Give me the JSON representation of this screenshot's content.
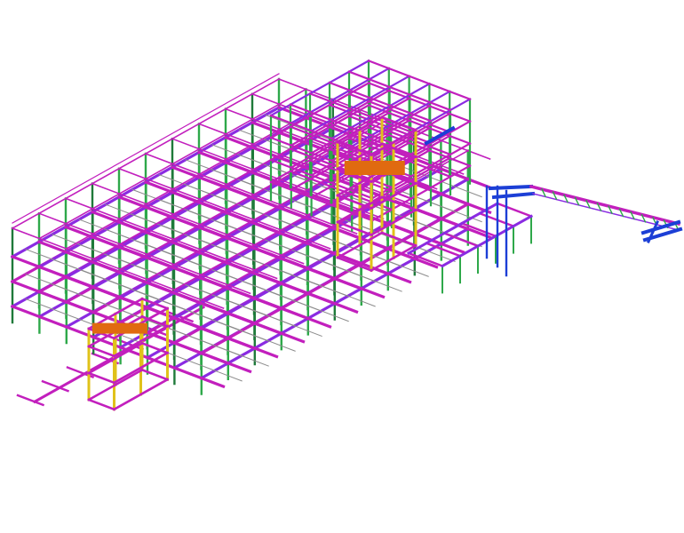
{
  "viewport": {
    "background": "#ffffff"
  },
  "model": {
    "view": "isometric-3d",
    "description_type": "structural-steel-frame",
    "colors": {
      "beam_primary": "#c21fbd",
      "beam_secondary": "#8a2be2",
      "column": "#2ea84a",
      "column_alt": "#1f7a3a",
      "brace": "#e0c21a",
      "stair_bracing": "#f0d000",
      "platform_orange": "#e06a10",
      "conveyor_blue": "#1c3fd6",
      "grey_member": "#8c8c8c",
      "pipe_cyan": "#1aa7c9"
    },
    "icons": {
      "main_frame": "steel-frame-icon",
      "tower": "tower-icon",
      "conveyor": "conveyor-icon"
    }
  }
}
